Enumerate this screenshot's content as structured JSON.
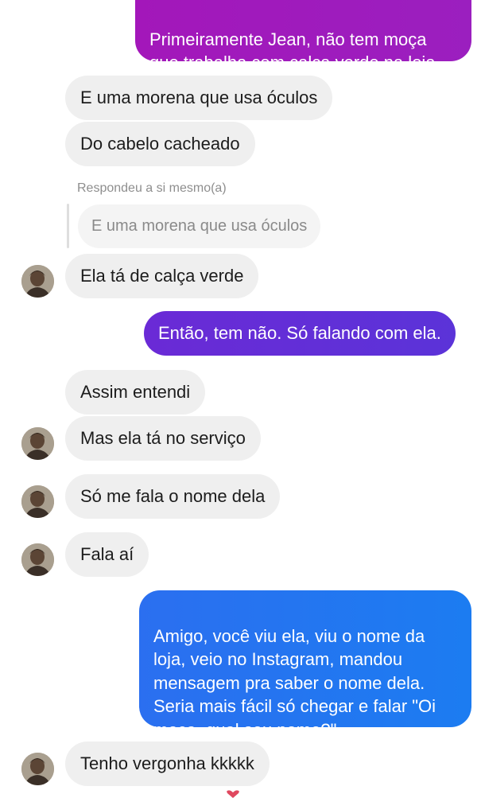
{
  "messages": [
    {
      "text": "Primeiramente Jean, não tem moça\nque trabalha com calça verde na loja."
    },
    {
      "text": "E uma morena que usa óculos"
    },
    {
      "text": "Do cabelo cacheado"
    },
    {
      "reply_label": "Respondeu a si mesmo(a)",
      "quoted": "E uma morena que usa óculos"
    },
    {
      "text": "Ela tá de calça verde"
    },
    {
      "text": "Então, tem não. Só falando com ela."
    },
    {
      "text": "Assim entendi"
    },
    {
      "text": "Mas ela tá no serviço"
    },
    {
      "text": "Só me fala o nome dela"
    },
    {
      "text": "Fala aí"
    },
    {
      "text": "Amigo, você viu ela, viu o nome da\nloja, veio no Instagram, mandou\nmensagem pra saber o nome dela.\nSeria mais fácil só chegar e falar \"Oi\nmoça, qual seu nome?\""
    },
    {
      "text": "Tenho vergonha kkkkk"
    }
  ],
  "colors": {
    "incoming_bubble": "#efefef",
    "outgoing_gradient": [
      "#a414b7",
      "#5d31d8",
      "#1c7cf1"
    ],
    "reply_text": "#8e8e8e"
  },
  "icons": {
    "avatar": "contact-avatar-photo",
    "reaction": "heart-reaction-icon"
  }
}
